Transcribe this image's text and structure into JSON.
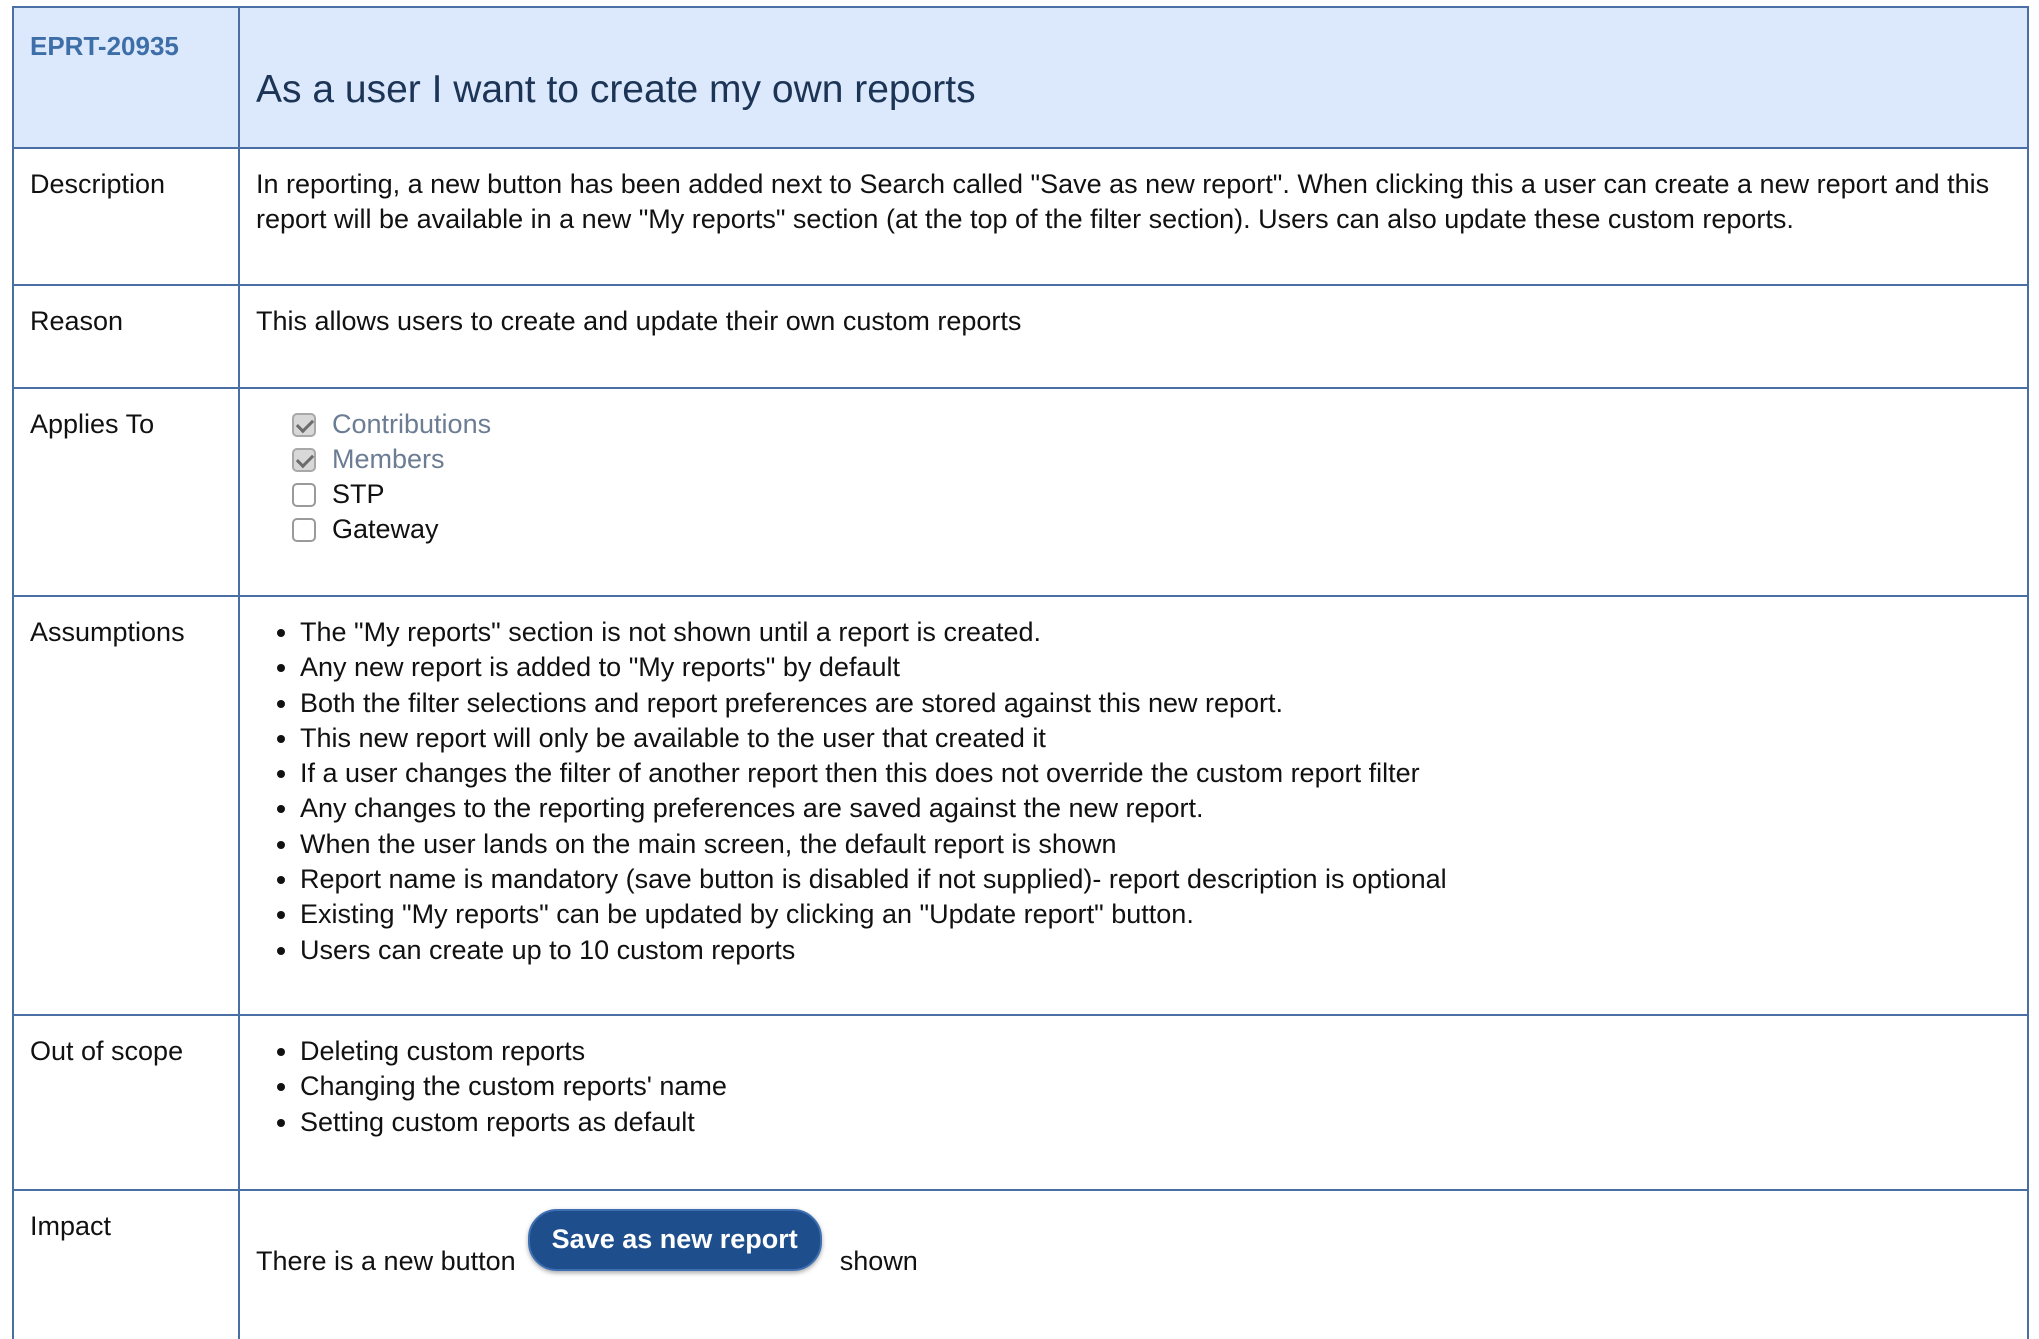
{
  "story": {
    "id": "EPRT-20935",
    "title": "As a user I want to create my own reports"
  },
  "labels": {
    "description": "Description",
    "reason": "Reason",
    "applies_to": "Applies To",
    "assumptions": "Assumptions",
    "out_of_scope": "Out of scope",
    "impact": "Impact"
  },
  "description": {
    "text": "In reporting, a new button has been added next to Search called \"Save as new report\". When clicking this a user can create a new report and this report will be available in a new \"My reports\" section (at the top of the filter section). Users can also update these custom reports."
  },
  "reason": {
    "text": "This allows users to create and update their own custom reports"
  },
  "applies_to": {
    "items": [
      {
        "label": "Contributions",
        "checked": true
      },
      {
        "label": "Members",
        "checked": true
      },
      {
        "label": "STP",
        "checked": false
      },
      {
        "label": "Gateway",
        "checked": false
      }
    ]
  },
  "assumptions": {
    "items": [
      "The \"My reports\" section is not shown until a report is created.",
      "Any new report is added to \"My reports\" by default",
      "Both the filter selections and report preferences are stored against this new report.",
      "This new report will only be available to the user that created it",
      "If a user changes the filter of another report then this does not override the custom report filter",
      "Any changes to the reporting preferences are saved against the new report.",
      "When the user lands on the main screen, the default report is shown",
      "Report name is mandatory (save button is disabled if not supplied)- report description is optional",
      "Existing \"My reports\" can be updated by clicking an \"Update report\" button.",
      "Users can create up to 10 custom reports"
    ]
  },
  "out_of_scope": {
    "items": [
      "Deleting custom reports",
      "Changing the custom reports' name",
      "Setting custom reports as default"
    ]
  },
  "impact": {
    "text_before": "There is a new button",
    "button_label": "Save as new report",
    "text_after": "shown"
  },
  "colors": {
    "header_bg": "#dce9fc",
    "border": "#4a6fa5",
    "id_text": "#3d6ea8",
    "button_bg": "#1f4e8c"
  }
}
